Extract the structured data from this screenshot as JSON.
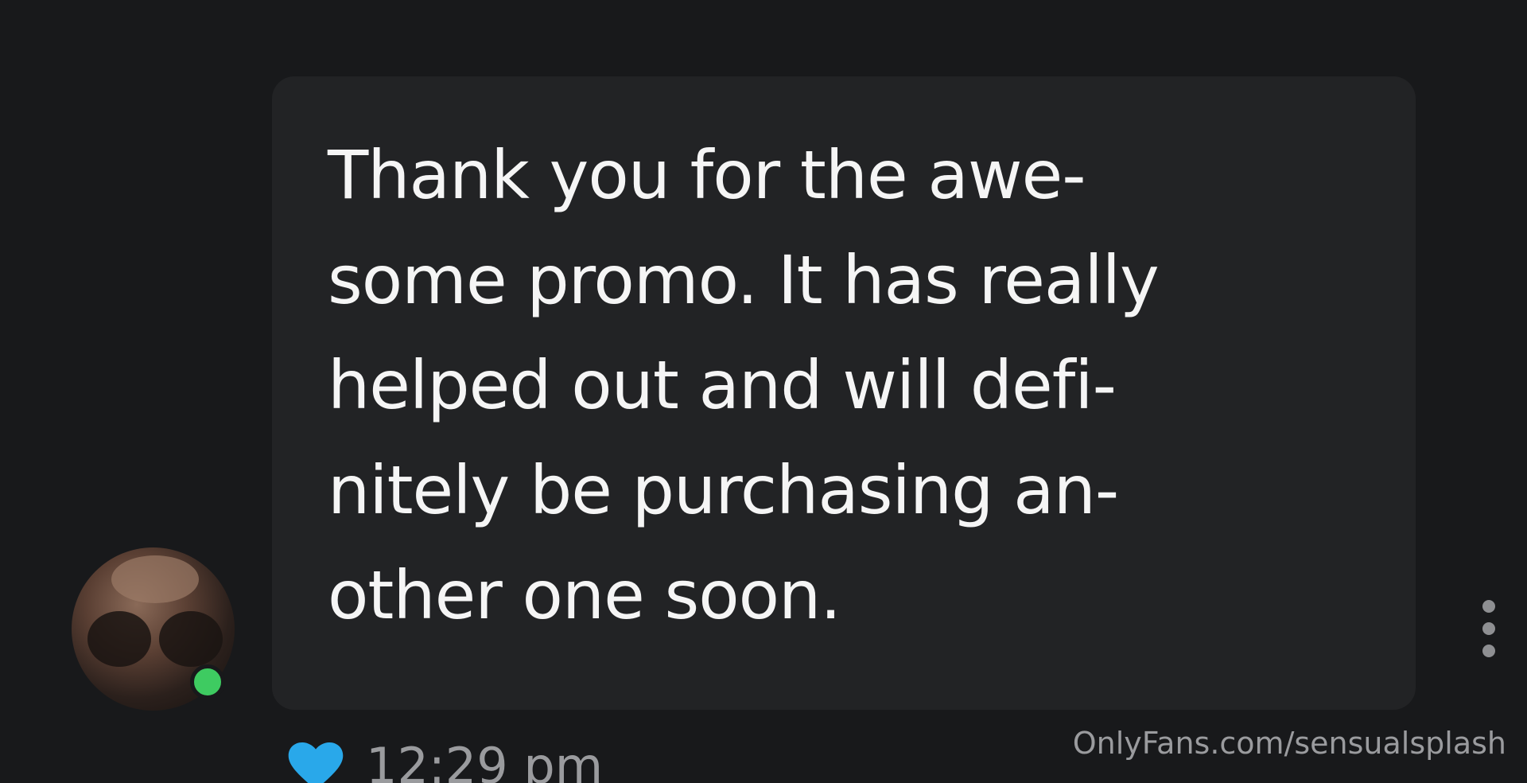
{
  "message": {
    "lines": [
      "Thank you for the awe-",
      "some promo. It has really",
      "helped out and will defi-",
      "nitely be purchasing an-",
      "other one soon."
    ]
  },
  "meta": {
    "time": "12:29 pm",
    "heart_icon": "heart-icon",
    "heart_color": "#29a8ea"
  },
  "avatar": {
    "status_color": "#3ecb61"
  },
  "watermark": "OnlyFans.com/sensualsplash",
  "colors": {
    "background": "#18191b",
    "bubble": "#222325",
    "text": "#f5f5f5",
    "muted": "#9a9b9e"
  }
}
